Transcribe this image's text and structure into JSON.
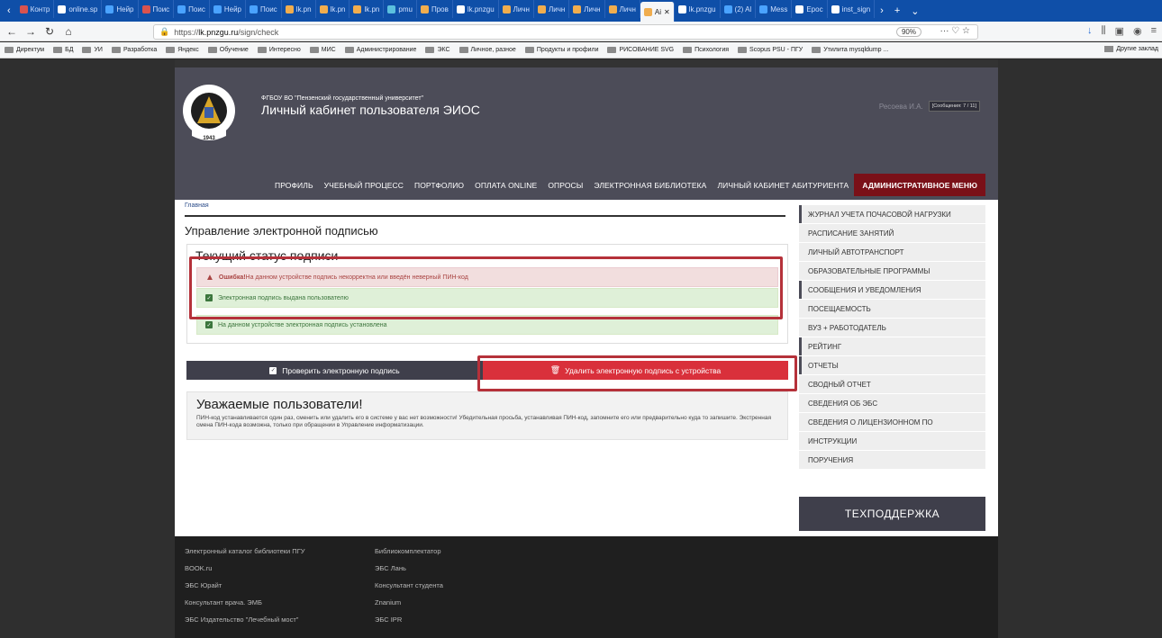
{
  "browser": {
    "tabs": [
      {
        "label": "Контр",
        "color": "#d9534f"
      },
      {
        "label": "online.sp",
        "color": "#ffffff"
      },
      {
        "label": "Нейр",
        "color": "#4aa3ff"
      },
      {
        "label": "Поис",
        "color": "#d9534f"
      },
      {
        "label": "Поис",
        "color": "#4aa3ff"
      },
      {
        "label": "Нейр",
        "color": "#4aa3ff"
      },
      {
        "label": "Поис",
        "color": "#4aa3ff"
      },
      {
        "label": "lk.pn",
        "color": "#f0ad4e"
      },
      {
        "label": "lk.pn",
        "color": "#f0ad4e"
      },
      {
        "label": "lk.pn",
        "color": "#f0ad4e"
      },
      {
        "label": "pmu",
        "color": "#5bc0de"
      },
      {
        "label": "Пров",
        "color": "#f0ad4e"
      },
      {
        "label": "lk.pnzgu",
        "color": "#ffffff"
      },
      {
        "label": "Личн",
        "color": "#f0ad4e"
      },
      {
        "label": "Личн",
        "color": "#f0ad4e"
      },
      {
        "label": "Личн",
        "color": "#f0ad4e"
      },
      {
        "label": "Личн",
        "color": "#f0ad4e"
      },
      {
        "label": "Ai",
        "color": "#f0ad4e",
        "active": true
      },
      {
        "label": "lk.pnzgu",
        "color": "#ffffff"
      },
      {
        "label": "(2) Al",
        "color": "#4aa3ff"
      },
      {
        "label": "Mess",
        "color": "#4aa3ff"
      },
      {
        "label": "Epoc",
        "color": "#ffffff"
      },
      {
        "label": "inst_sign",
        "color": "#ffffff"
      }
    ],
    "url_prefix": "https://",
    "url_host": "lk.pnzgu.ru",
    "url_path": "/sign/check",
    "zoom": "90%",
    "bookmarks": [
      "Директум",
      "БД",
      "УИ",
      "Разработка",
      "Яндекс",
      "Обучение",
      "Интересно",
      "МИС",
      "Администрирование",
      "ЭКС",
      "Личное, разное",
      "Продукты и профили",
      "РИСОВАНИЕ SVG",
      "Психология",
      "Scopus PSU - ПГУ",
      "Утилита mysqldump ..."
    ],
    "bookmarks_other": "Другие заклад"
  },
  "header": {
    "org": "ФГБОУ ВО \"Пензенский государственный университет\"",
    "title": "Личный кабинет пользователя ЭИОС",
    "user": "Ресоева И.А.",
    "messages": "[Сообщения: 7 / 11]",
    "logo_year": "1943"
  },
  "nav": [
    "ПРОФИЛЬ",
    "УЧЕБНЫЙ ПРОЦЕСС",
    "ПОРТФОЛИО",
    "ОПЛАТА ONLINE",
    "ОПРОСЫ",
    "ЭЛЕКТРОННАЯ БИБЛИОТЕКА",
    "ЛИЧНЫЙ КАБИНЕТ АБИТУРИЕНТА",
    "АДМИНИСТРАТИВНОЕ МЕНЮ"
  ],
  "main": {
    "breadcrumb": "Главная",
    "page_title": "Управление электронной подписью",
    "status_title": "Текущий статус подписи",
    "error_label": "Ошибка!",
    "error_text": " На данном устройстве подпись некорректна или введён неверный ПИН-код",
    "ok1": "Электронная подпись выдана пользователю",
    "ok2": "На данном устройстве электронная подпись установлена",
    "btn_check": "Проверить электронную подпись",
    "btn_delete": "Удалить электронную подпись с устройства",
    "notice_title": "Уважаемые пользователи!",
    "notice_text": "ПИН-код устанавливается один раз, сменить или удалить его в системе у вас нет возможности! Убедительная просьба, устанавливая ПИН-код, запомните его или предварительно куда то запишите. Экстренная смена ПИН-кода возможна, только при обращении в Управление информатизации."
  },
  "sidebar": [
    {
      "label": "ЖУРНАЛ УЧЕТА ПОЧАСОВОЙ НАГРУЗКИ",
      "marked": true
    },
    {
      "label": "РАСПИСАНИЕ ЗАНЯТИЙ",
      "marked": false
    },
    {
      "label": "ЛИЧНЫЙ АВТОТРАНСПОРТ",
      "marked": false
    },
    {
      "label": "ОБРАЗОВАТЕЛЬНЫЕ ПРОГРАММЫ",
      "marked": false
    },
    {
      "label": "СООБЩЕНИЯ И УВЕДОМЛЕНИЯ",
      "marked": true
    },
    {
      "label": "ПОСЕЩАЕМОСТЬ",
      "marked": false
    },
    {
      "label": "ВУЗ + РАБОТОДАТЕЛЬ",
      "marked": false
    },
    {
      "label": "РЕЙТИНГ",
      "marked": true
    },
    {
      "label": "ОТЧЕТЫ",
      "marked": true
    },
    {
      "label": "СВОДНЫЙ ОТЧЕТ",
      "marked": false
    },
    {
      "label": "СВЕДЕНИЯ ОБ ЭБС",
      "marked": false
    },
    {
      "label": "СВЕДЕНИЯ О ЛИЦЕНЗИОННОМ ПО",
      "marked": false
    },
    {
      "label": "ИНСТРУКЦИИ",
      "marked": false
    },
    {
      "label": "ПОРУЧЕНИЯ",
      "marked": false
    }
  ],
  "support": "ТЕХПОДДЕРЖКА",
  "footer": {
    "col1": [
      "Электронный каталог библиотеки ПГУ",
      "BOOK.ru",
      "ЭБС Юрайт",
      "Консультант врача. ЭМБ",
      "ЭБС Издательство \"Лечебный мост\""
    ],
    "col2": [
      "Библиокомплектатор",
      "ЭБС Лань",
      "Консультант студента",
      "Znanium",
      "ЭБС IPR"
    ]
  },
  "colors": {
    "accent_red": "#d9303b",
    "admin_menu": "#7a1018",
    "header_bg": "#4c4c58",
    "annotation": "#b5313a"
  }
}
